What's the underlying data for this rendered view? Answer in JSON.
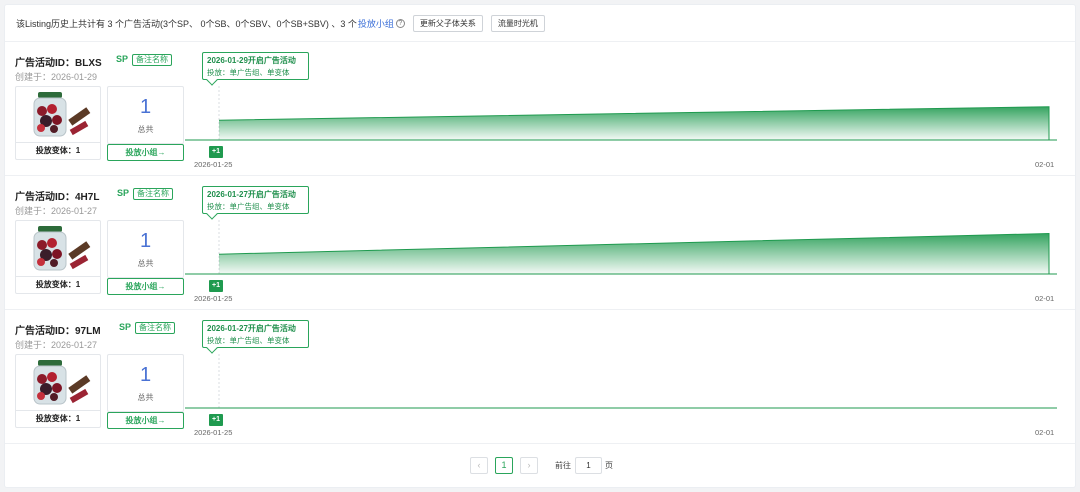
{
  "summary": {
    "text": "该Listing历史上共计有 3 个广告活动(3个SP、 0个SB、0个SBV、0个SB+SBV) 、3 个",
    "link": "投放小组",
    "help_icon": "question-circle-icon",
    "btn_update": "更新父子体关系",
    "btn_timemachine": "流量时光机"
  },
  "campaigns": [
    {
      "id_label": "广告活动ID：BLXS",
      "type": "SP",
      "note_btn": "备注名称",
      "created": "创建于：2026-01-29",
      "variants": "投放变体：1",
      "total_num": "1",
      "total_label": "总共",
      "group_btn": "投放小组→",
      "tip_title": "2026-01-29开启广告活动",
      "tip_sub": "投放：单广告组、单变体",
      "plus": "+1",
      "date_start": "2026-01-25",
      "date_end": "02-01",
      "trend": [
        0.22,
        0.37
      ]
    },
    {
      "id_label": "广告活动ID：4H7L",
      "type": "SP",
      "note_btn": "备注名称",
      "created": "创建于：2026-01-27",
      "variants": "投放变体：1",
      "total_num": "1",
      "total_label": "总共",
      "group_btn": "投放小组→",
      "tip_title": "2026-01-27开启广告活动",
      "tip_sub": "投放：单广告组、单变体",
      "plus": "+1",
      "date_start": "2026-01-25",
      "date_end": "02-01",
      "trend": [
        0.22,
        0.45
      ]
    },
    {
      "id_label": "广告活动ID：97LM",
      "type": "SP",
      "note_btn": "备注名称",
      "created": "创建于：2026-01-27",
      "variants": "投放变体：1",
      "total_num": "1",
      "total_label": "总共",
      "group_btn": "投放小组→",
      "tip_title": "2026-01-27开启广告活动",
      "tip_sub": "投放：单广告组、单变体",
      "plus": "+1",
      "date_start": "2026-01-25",
      "date_end": "02-01",
      "trend": [
        0.0,
        0.0
      ]
    }
  ],
  "pagination": {
    "prev": "‹",
    "current": "1",
    "next": "›",
    "goto_label": "前往",
    "goto_value": "1",
    "page_suffix": "页"
  },
  "colors": {
    "accent": "#2aa55b",
    "link": "#3b6fd8",
    "number": "#4a72d4"
  }
}
